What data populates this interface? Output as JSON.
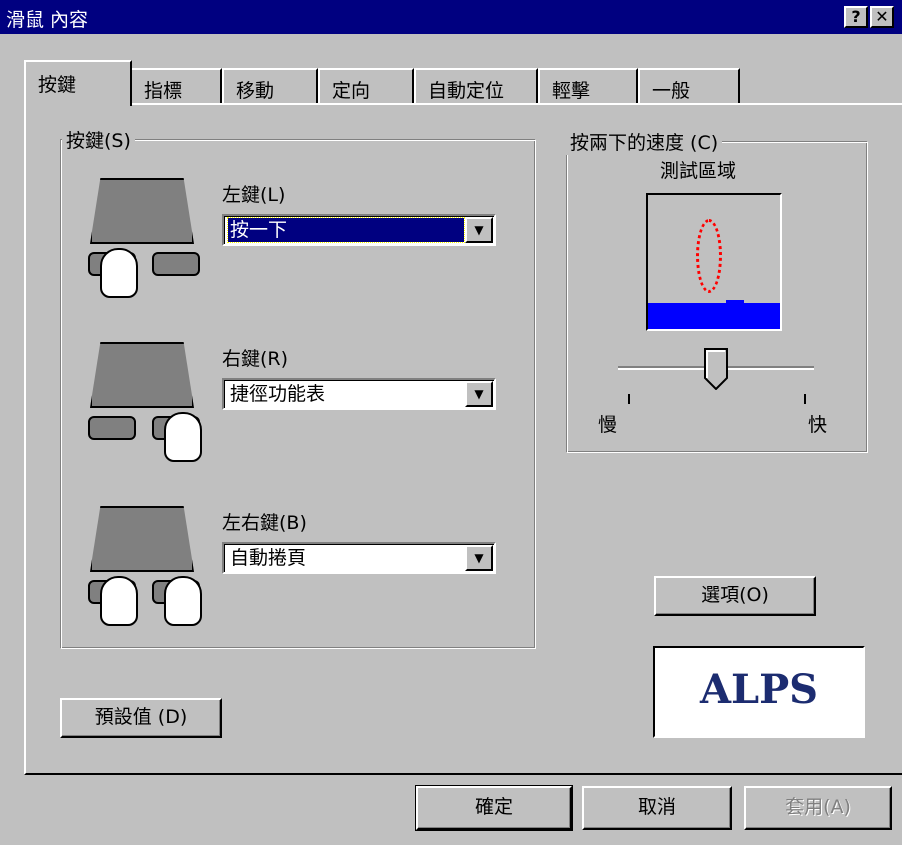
{
  "window": {
    "title": "滑鼠 內容",
    "help_label": "?",
    "close_label": "✕"
  },
  "tabs": [
    "按鍵",
    "指標",
    "移動",
    "定向",
    "自動定位",
    "輕擊",
    "一般"
  ],
  "buttons_group": {
    "legend": "按鍵(S)",
    "left": {
      "label": "左鍵(L)",
      "value": "按一下"
    },
    "right": {
      "label": "右鍵(R)",
      "value": "捷徑功能表"
    },
    "both": {
      "label": "左右鍵(B)",
      "value": "自動捲頁"
    }
  },
  "double_click": {
    "legend": "按兩下的速度 (C)",
    "test_area_label": "測試區域",
    "slow_label": "慢",
    "fast_label": "快",
    "speed_level": 0.5
  },
  "options_button": "選項(O)",
  "logo_text": "ALPS",
  "defaults_button": "預設值 (D)",
  "footer": {
    "ok": "確定",
    "cancel": "取消",
    "apply": "套用(A)"
  },
  "colors": {
    "titlebar": "#000080",
    "face": "#c0c0c0",
    "selection": "#000080",
    "logo": "#1c2c70",
    "test_water": "#0000ff",
    "test_ring": "#ff0000"
  }
}
